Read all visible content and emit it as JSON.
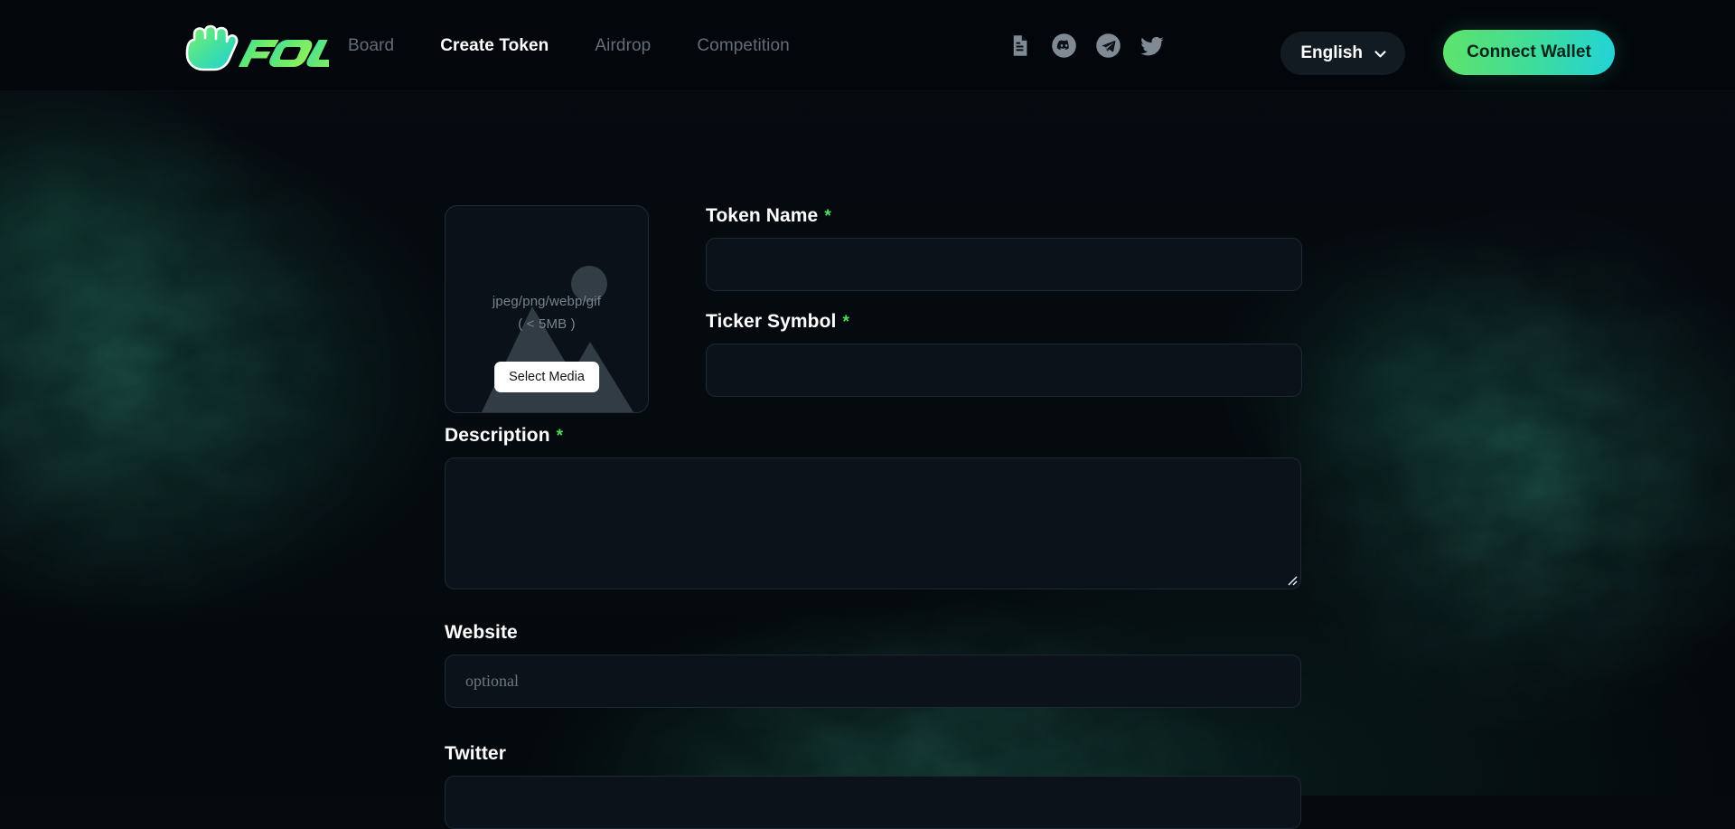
{
  "brand": {
    "name": "FOUR",
    "logo_icon": "four-finger-hand-icon",
    "gradient_start": "#5fe36b",
    "gradient_end": "#22d3d8"
  },
  "nav": {
    "links": [
      {
        "label": "Board",
        "active": false
      },
      {
        "label": "Create Token",
        "active": true
      },
      {
        "label": "Airdrop",
        "active": false
      },
      {
        "label": "Competition",
        "active": false
      }
    ],
    "social_icons": [
      {
        "name": "docs-icon"
      },
      {
        "name": "discord-icon"
      },
      {
        "name": "telegram-icon"
      },
      {
        "name": "twitter-icon"
      }
    ],
    "language": {
      "selected": "English",
      "chevron": "chevron-down-icon"
    },
    "connect_wallet_label": "Connect Wallet"
  },
  "form": {
    "media": {
      "formats_text": "jpeg/png/webp/gif",
      "size_text": "( < 5MB )",
      "button_label": "Select Media",
      "placeholder_icon": "image-placeholder-icon"
    },
    "fields": {
      "token_name": {
        "label": "Token Name",
        "required_marker": "*",
        "value": "",
        "placeholder": ""
      },
      "ticker_symbol": {
        "label": "Ticker Symbol",
        "required_marker": "*",
        "value": "",
        "placeholder": ""
      },
      "description": {
        "label": "Description",
        "required_marker": "*",
        "value": "",
        "placeholder": ""
      },
      "website": {
        "label": "Website",
        "value": "",
        "placeholder": "optional"
      },
      "twitter": {
        "label": "Twitter",
        "value": "",
        "placeholder": ""
      }
    }
  },
  "colors": {
    "accent_green": "#4ade5c",
    "accent_cyan": "#22d3d8",
    "page_bg": "#050a0e",
    "nav_bg": "#03070b",
    "input_bg": "#0b1219",
    "input_border": "#1e2936"
  }
}
